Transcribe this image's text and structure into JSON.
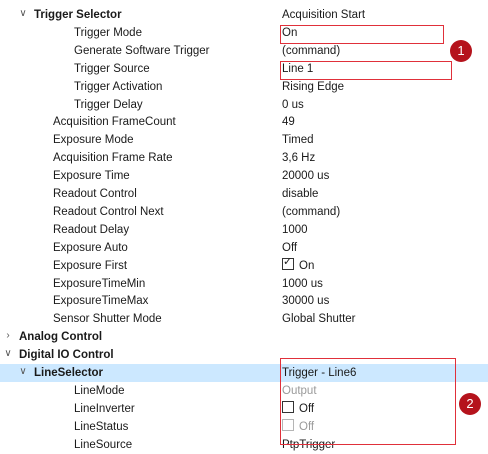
{
  "rows": [
    {
      "name": "Trigger Selector",
      "value": "Acquisition Start",
      "expander": "v",
      "level": 1,
      "bold": true
    },
    {
      "name": "Trigger Mode",
      "value": "On",
      "level": 3
    },
    {
      "name": "Generate Software Trigger",
      "value": "(command)",
      "level": 3
    },
    {
      "name": "Trigger Source",
      "value": "Line 1",
      "level": 3
    },
    {
      "name": "Trigger Activation",
      "value": "Rising Edge",
      "level": 3
    },
    {
      "name": "Trigger Delay",
      "value": "0 us",
      "level": 3
    },
    {
      "name": "Acquisition FrameCount",
      "value": "49",
      "level": 2
    },
    {
      "name": "Exposure Mode",
      "value": "Timed",
      "level": 2
    },
    {
      "name": "Acquisition Frame Rate",
      "value": "3,6 Hz",
      "level": 2
    },
    {
      "name": "Exposure Time",
      "value": "20000 us",
      "level": 2
    },
    {
      "name": "Readout Control",
      "value": "disable",
      "level": 2
    },
    {
      "name": "Readout Control Next",
      "value": "(command)",
      "level": 2
    },
    {
      "name": "Readout Delay",
      "value": "1000",
      "level": 2
    },
    {
      "name": "Exposure Auto",
      "value": "Off",
      "level": 2
    },
    {
      "name": "Exposure First",
      "value": "On",
      "level": 2,
      "checkbox": true,
      "checked": true
    },
    {
      "name": "ExposureTimeMin",
      "value": "1000 us",
      "level": 2
    },
    {
      "name": "ExposureTimeMax",
      "value": "30000 us",
      "level": 2
    },
    {
      "name": "Sensor Shutter Mode",
      "value": "Global Shutter",
      "level": 2
    },
    {
      "name": "Analog Control",
      "value": "",
      "expander": ">",
      "level": 0,
      "bold": true
    },
    {
      "name": "Digital IO Control",
      "value": "",
      "expander": "v",
      "level": 0,
      "bold": true
    },
    {
      "name": "LineSelector",
      "value": "Trigger - Line6",
      "expander": "v",
      "level": 1,
      "bold": true,
      "highlight": true
    },
    {
      "name": "LineMode",
      "value": "Output",
      "level": 3,
      "disabled_value": true
    },
    {
      "name": "LineInverter",
      "value": "Off",
      "level": 3,
      "checkbox": true,
      "checked": false
    },
    {
      "name": "LineStatus",
      "value": "Off",
      "level": 3,
      "checkbox": true,
      "checked": false,
      "disabled_value": true
    },
    {
      "name": "LineSource",
      "value": "PtpTrigger",
      "level": 3
    }
  ],
  "badges": [
    "1",
    "2"
  ],
  "colors": {
    "highlight": "#cce8ff",
    "annotation": "#e0303a",
    "badge": "#b5131c"
  }
}
